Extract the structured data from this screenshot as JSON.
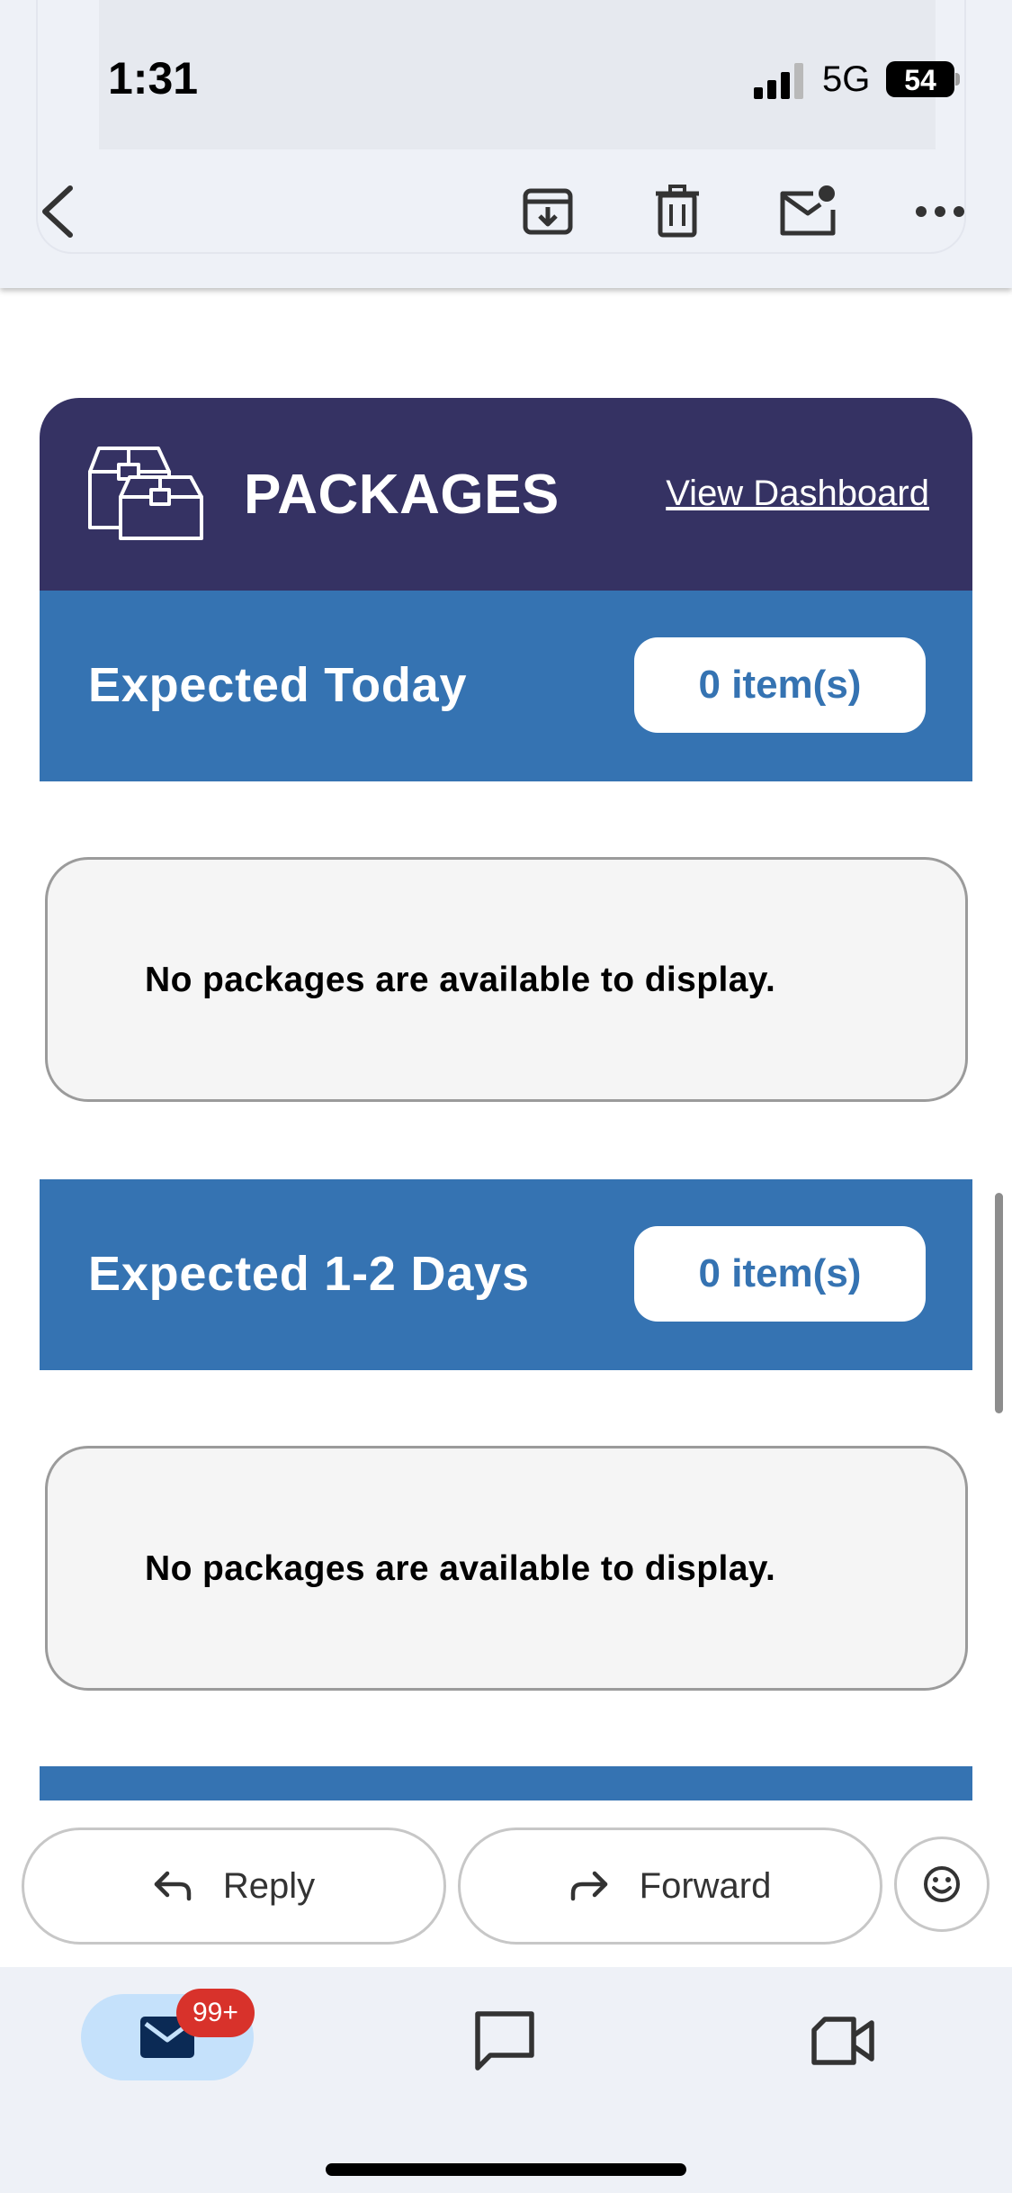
{
  "status_bar": {
    "time": "1:31",
    "network": "5G",
    "battery": "54"
  },
  "toolbar": {
    "icons": [
      "back-chevron-icon",
      "archive-icon",
      "delete-icon",
      "mark-unread-icon",
      "more-horizontal-icon"
    ]
  },
  "packages": {
    "title": "PACKAGES",
    "dashboard_link": "View Dashboard",
    "icon": "boxes-icon",
    "header_color": "#353263",
    "section_color": "#3573b2",
    "sections": [
      {
        "title": "Expected Today",
        "count": "0 item(s)",
        "empty_message": "No packages are available to display."
      },
      {
        "title": "Expected 1-2 Days",
        "count": "0 item(s)",
        "empty_message": "No packages are available to display."
      }
    ]
  },
  "actions": {
    "reply": "Reply",
    "forward": "Forward",
    "emoji_icon": "smiley-icon"
  },
  "bottom_nav": {
    "mail_badge": "99+",
    "badge_color": "#d8322b",
    "items": [
      "mail-icon",
      "chat-icon",
      "meet-icon"
    ]
  }
}
